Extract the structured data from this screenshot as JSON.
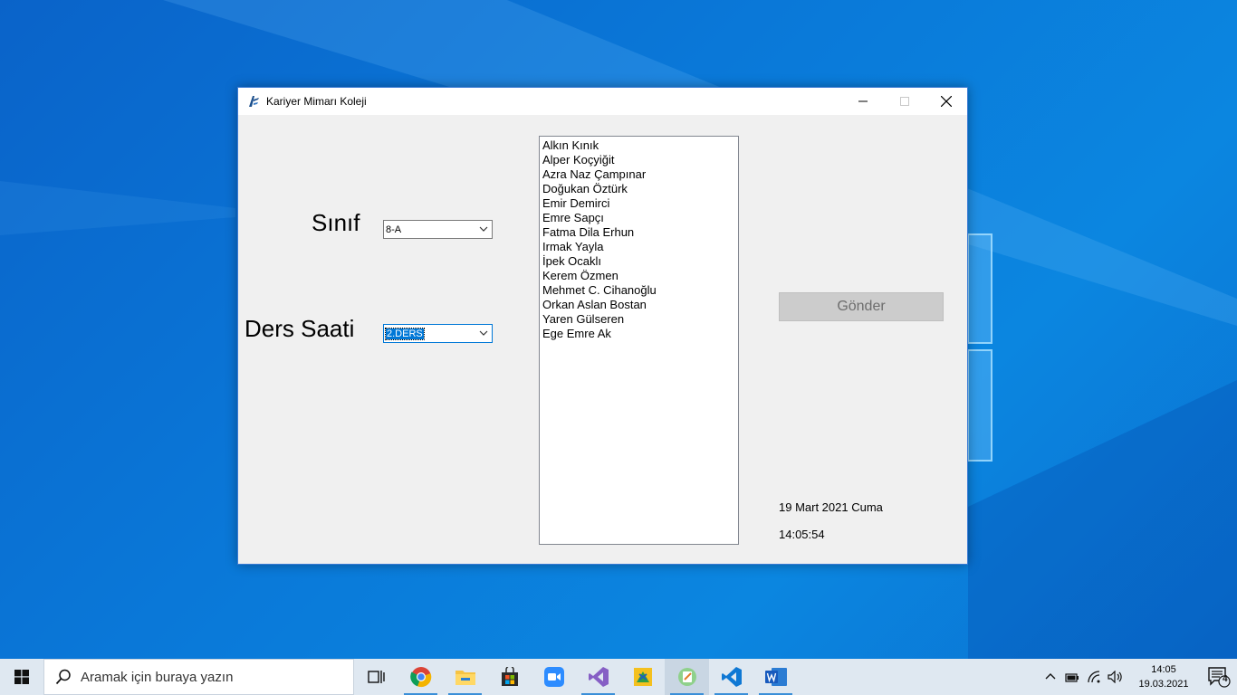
{
  "window": {
    "title": "Kariyer Mimarı Koleji"
  },
  "form": {
    "sinif_label": "Sınıf",
    "ders_saati_label": "Ders Saati",
    "sinif_value": "8-A",
    "ders_saati_value": "2.DERS",
    "send_label": "Gönder",
    "date_text": "19 Mart 2021 Cuma",
    "time_text": "14:05:54"
  },
  "students": [
    "Alkın Kınık",
    "Alper Koçyiğit",
    "Azra Naz Çampınar",
    "Doğukan Öztürk",
    "Emir Demirci",
    "Emre Sapçı",
    "Fatma Dila Erhun",
    "Irmak Yayla",
    "İpek Ocaklı",
    "Kerem Özmen",
    "Mehmet C. Cihanoğlu",
    "Orkan Aslan Bostan",
    "Yaren Gülseren",
    "Ege Emre Ak"
  ],
  "taskbar": {
    "search_placeholder": "Aramak için buraya yazın",
    "clock_time": "14:05",
    "clock_date": "19.03.2021",
    "notification_count": "4",
    "apps": [
      "task-view",
      "chrome",
      "file-explorer",
      "microsoft-store",
      "zoom",
      "visual-studio",
      "dev-tool",
      "app-running",
      "vscode",
      "word"
    ]
  },
  "colors": {
    "accent": "#0078d7",
    "desktop": "#0a78d8",
    "window_bg": "#f0f0f0",
    "button_disabled": "#cccccc"
  }
}
